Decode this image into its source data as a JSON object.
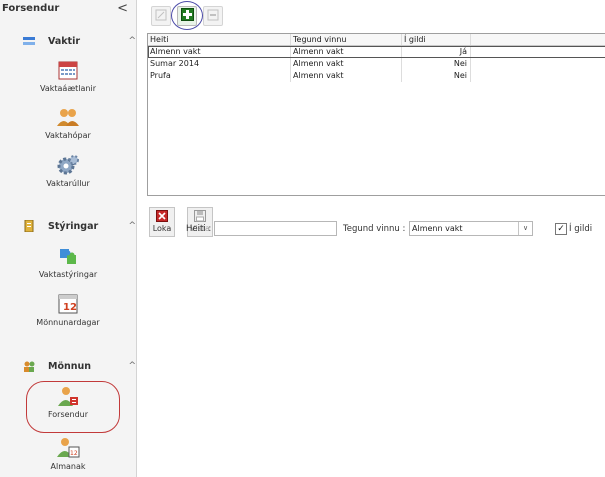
{
  "sidebar": {
    "title": "Forsendur",
    "collapse_glyph": "<",
    "groups": [
      {
        "label": "Vaktir",
        "caret": "^",
        "icon": "calendar-icon",
        "items": [
          {
            "label": "Vaktaáætlanir",
            "icon": "calendar-grid-icon"
          },
          {
            "label": "Vaktahópar",
            "icon": "group-people-icon"
          },
          {
            "label": "Vaktarúllur",
            "icon": "gears-icon"
          }
        ]
      },
      {
        "label": "Stýringar",
        "caret": "^",
        "icon": "clipboard-icon",
        "items": [
          {
            "label": "Vaktastýringar",
            "icon": "puzzle-people-icon"
          },
          {
            "label": "Mönnunardagar",
            "icon": "calendar-12-icon"
          }
        ]
      },
      {
        "label": "Mönnun",
        "caret": "^",
        "icon": "people-icon",
        "items": [
          {
            "label": "Forsendur",
            "icon": "person-settings-icon"
          },
          {
            "label": "Almanak",
            "icon": "person-calendar-icon"
          }
        ]
      }
    ]
  },
  "grid": {
    "columns": [
      "Heiti",
      "Tegund vinnu",
      "Í gildi"
    ],
    "rows": [
      {
        "heiti": "Almenn vakt",
        "tegund": "Almenn vakt",
        "gildi": "Já"
      },
      {
        "heiti": "Sumar 2014",
        "tegund": "Almenn vakt",
        "gildi": "Nei"
      },
      {
        "heiti": "Prufa",
        "tegund": "Almenn vakt",
        "gildi": "Nei"
      }
    ]
  },
  "actions": {
    "close_label": "Loka",
    "save_label": "Vista"
  },
  "form": {
    "heiti_label": "Heiti :",
    "heiti_value": "",
    "tegund_label": "Tegund vinnu :",
    "tegund_value": "Almenn vakt",
    "gildi_label": "Í gildi",
    "gildi_checked": "✓"
  },
  "colors": {
    "accent_red": "#c23a3a",
    "add_green": "#2e9a2e"
  }
}
